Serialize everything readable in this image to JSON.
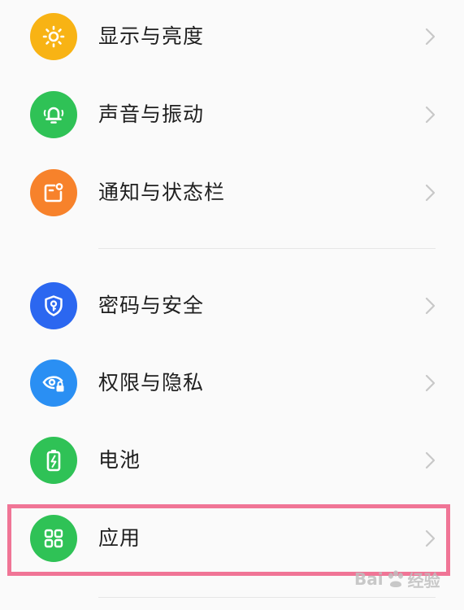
{
  "settings": {
    "items": [
      {
        "label": "显示与亮度",
        "icon": "sun-icon",
        "color": "#f8b314"
      },
      {
        "label": "声音与振动",
        "icon": "bell-icon",
        "color": "#2fc256"
      },
      {
        "label": "通知与状态栏",
        "icon": "notification-icon",
        "color": "#f7822b"
      },
      {
        "label": "密码与安全",
        "icon": "shield-key-icon",
        "color": "#2b67f0"
      },
      {
        "label": "权限与隐私",
        "icon": "eye-lock-icon",
        "color": "#2a8ff3"
      },
      {
        "label": "电池",
        "icon": "battery-icon",
        "color": "#2fc256"
      },
      {
        "label": "应用",
        "icon": "apps-grid-icon",
        "color": "#2fc256"
      }
    ]
  },
  "watermark": {
    "brand": "Bai",
    "brand_suffix": "经验"
  },
  "colors": {
    "highlight": "#f07596",
    "divider": "#e6e6e6",
    "chevron": "#c8c8c8"
  }
}
